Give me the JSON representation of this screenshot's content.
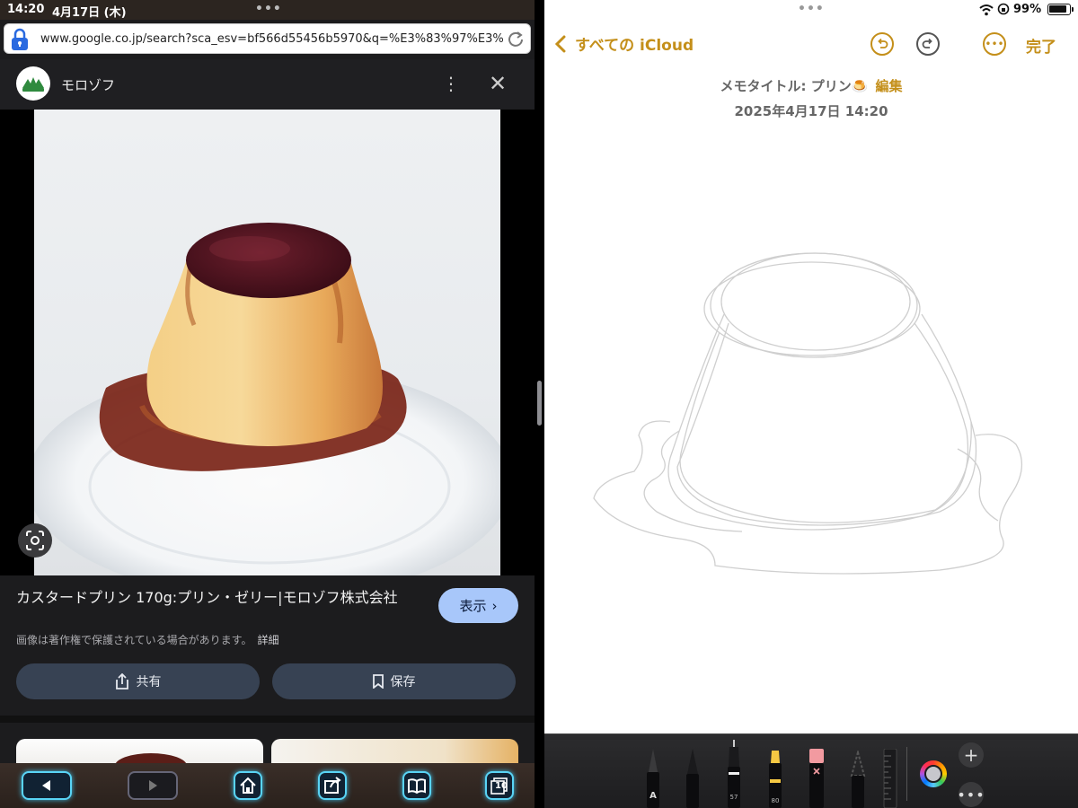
{
  "left_status": {
    "time": "14:20",
    "date": "4月17日 (木)"
  },
  "browser": {
    "url": "www.google.co.jp/search?sca_esv=bf566d55456b5970&q=%E3%83%97%E3%83%..."
  },
  "image_panel": {
    "site_name": "モロゾフ",
    "result_title": "カスタードプリン 170g:プリン・ゼリー|モロゾフ株式会社",
    "show_label": "表示",
    "copyright_note": "画像は著作権で保護されている場合があります。",
    "details_link": "詳細",
    "share_label": "共有",
    "save_label": "保存"
  },
  "bottom_nav": {
    "tabs_count": "10"
  },
  "right_status": {
    "battery": "99%"
  },
  "notes": {
    "back_label": "すべての iCloud",
    "done_label": "完了",
    "meta_title": "メモタイトル: プリン🍮",
    "edit_label": "編集",
    "date": "2025年4月17日 14:20"
  },
  "tools": {
    "pen_label": "A",
    "marker_size": "57",
    "highlighter_size": "80"
  },
  "colors": {
    "accent_gold": "#c48f1a",
    "google_blue_button": "#a8c7fa",
    "nav_glow": "#59d4f5"
  }
}
